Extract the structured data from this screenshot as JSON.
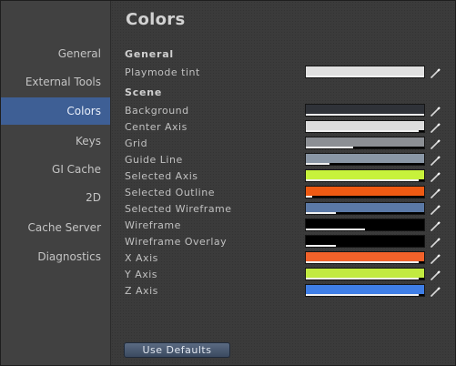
{
  "sidebar": {
    "items": [
      {
        "label": "General",
        "selected": false
      },
      {
        "label": "External Tools",
        "selected": false
      },
      {
        "label": "Colors",
        "selected": true
      },
      {
        "label": "Keys",
        "selected": false
      },
      {
        "label": "GI Cache",
        "selected": false
      },
      {
        "label": "2D",
        "selected": false
      },
      {
        "label": "Cache Server",
        "selected": false
      },
      {
        "label": "Diagnostics",
        "selected": false
      }
    ],
    "selected_color": "#3e5f95"
  },
  "main": {
    "title": "Colors",
    "general_header": "General",
    "scene_header": "Scene",
    "picker_icon": "eyedropper-icon",
    "general_rows": [
      {
        "label": "Playmode tint",
        "color": "#e0e0e0",
        "alpha": 1.0
      }
    ],
    "scene_rows": [
      {
        "label": "Background",
        "color": "#2f3238",
        "alpha": 1.0
      },
      {
        "label": "Center Axis",
        "color": "#dcdcdc",
        "alpha": 0.95
      },
      {
        "label": "Grid",
        "color": "#8c8f94",
        "alpha": 0.4
      },
      {
        "label": "Guide Line",
        "color": "#8a97a6",
        "alpha": 0.2
      },
      {
        "label": "Selected Axis",
        "color": "#c7f23b",
        "alpha": 0.95
      },
      {
        "label": "Selected Outline",
        "color": "#ef5a13",
        "alpha": 0.05
      },
      {
        "label": "Selected Wireframe",
        "color": "#5b79a6",
        "alpha": 0.25
      },
      {
        "label": "Wireframe",
        "color": "#000000",
        "alpha": 0.5
      },
      {
        "label": "Wireframe Overlay",
        "color": "#000000",
        "alpha": 0.25
      },
      {
        "label": "X Axis",
        "color": "#f2622a",
        "alpha": 0.95
      },
      {
        "label": "Y Axis",
        "color": "#c2ea40",
        "alpha": 0.95
      },
      {
        "label": "Z Axis",
        "color": "#3f7ee6",
        "alpha": 0.95
      }
    ]
  },
  "footer": {
    "use_defaults_label": "Use Defaults"
  }
}
